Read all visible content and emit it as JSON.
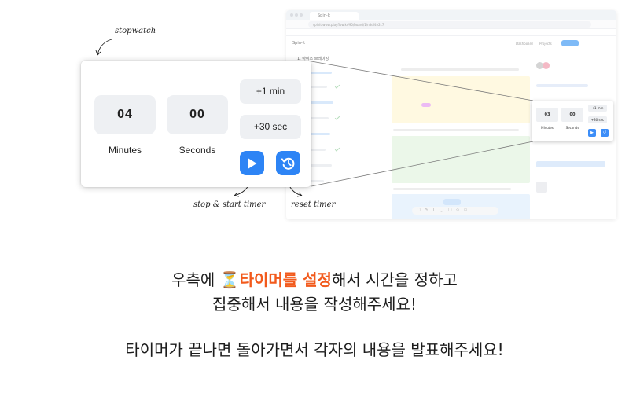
{
  "background": {
    "tab_title": "Spin-It",
    "url": "spinit.www.playflow.kr/90/board/1/n8df4e2c7",
    "brand": "Spin-It",
    "nav": [
      "Dashboard",
      "Projects"
    ],
    "sidebar_title": "1. 아이스 브레이킹"
  },
  "mini_timer": {
    "minutes": "03",
    "seconds": "00",
    "minutes_label": "Minutes",
    "seconds_label": "Seconds",
    "add_minute": "+1 min",
    "add_seconds": "+30 sec"
  },
  "timer": {
    "minutes": "04",
    "seconds": "00",
    "minutes_label": "Minutes",
    "seconds_label": "Seconds",
    "add_minute_label": "+1 min",
    "add_seconds_label": "+30 sec"
  },
  "annotations": {
    "stopwatch": "stopwatch",
    "start_stop": "stop & start timer",
    "reset": "reset timer"
  },
  "instructions": {
    "line1_before": "우측에 ",
    "line1_icon": "⏳",
    "line1_highlight": "타이머를 설정",
    "line1_after": "해서 시간을 정하고",
    "line2": "집중해서 내용을 작성해주세요!",
    "line3": "타이머가 끝나면 돌아가면서 각자의 내용을 발표해주세요!"
  },
  "colors": {
    "accent_blue": "#2d84f5",
    "highlight_orange": "#f25a1c"
  },
  "icons": [
    "play-icon",
    "reset-history-icon",
    "hourglass-icon",
    "arrow-icon"
  ]
}
